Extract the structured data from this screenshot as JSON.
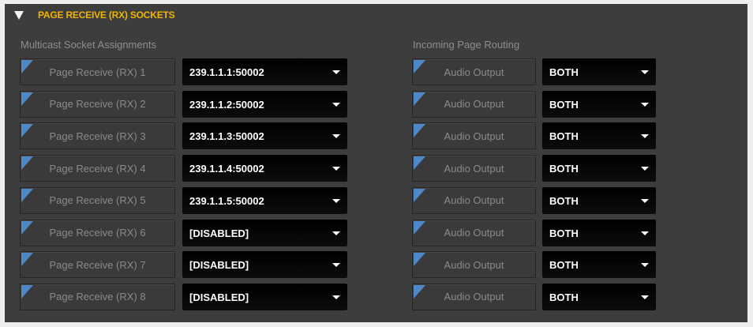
{
  "header": {
    "title": "PAGE RECEIVE (RX) SOCKETS"
  },
  "multicast": {
    "label": "Multicast Socket Assignments",
    "rows": [
      {
        "name": "Page Receive (RX) 1",
        "value": "239.1.1.1:50002"
      },
      {
        "name": "Page Receive (RX) 2",
        "value": "239.1.1.2:50002"
      },
      {
        "name": "Page Receive (RX) 3",
        "value": "239.1.1.3:50002"
      },
      {
        "name": "Page Receive (RX) 4",
        "value": "239.1.1.4:50002"
      },
      {
        "name": "Page Receive (RX) 5",
        "value": "239.1.1.5:50002"
      },
      {
        "name": "Page Receive (RX) 6",
        "value": "[DISABLED]"
      },
      {
        "name": "Page Receive (RX) 7",
        "value": "[DISABLED]"
      },
      {
        "name": "Page Receive (RX) 8",
        "value": "[DISABLED]"
      }
    ]
  },
  "routing": {
    "label": "Incoming Page Routing",
    "rows": [
      {
        "name": "Audio Output",
        "value": "BOTH"
      },
      {
        "name": "Audio Output",
        "value": "BOTH"
      },
      {
        "name": "Audio Output",
        "value": "BOTH"
      },
      {
        "name": "Audio Output",
        "value": "BOTH"
      },
      {
        "name": "Audio Output",
        "value": "BOTH"
      },
      {
        "name": "Audio Output",
        "value": "BOTH"
      },
      {
        "name": "Audio Output",
        "value": "BOTH"
      },
      {
        "name": "Audio Output",
        "value": "BOTH"
      }
    ]
  },
  "colors": {
    "accent": "#f0b400",
    "panel": "#3d3d3d",
    "corner": "#4e88c6",
    "select": "#000000"
  },
  "icons": {
    "collapse": "triangle-down-icon",
    "dropdown": "chevron-down-icon",
    "corner": "corner-marker-icon"
  }
}
